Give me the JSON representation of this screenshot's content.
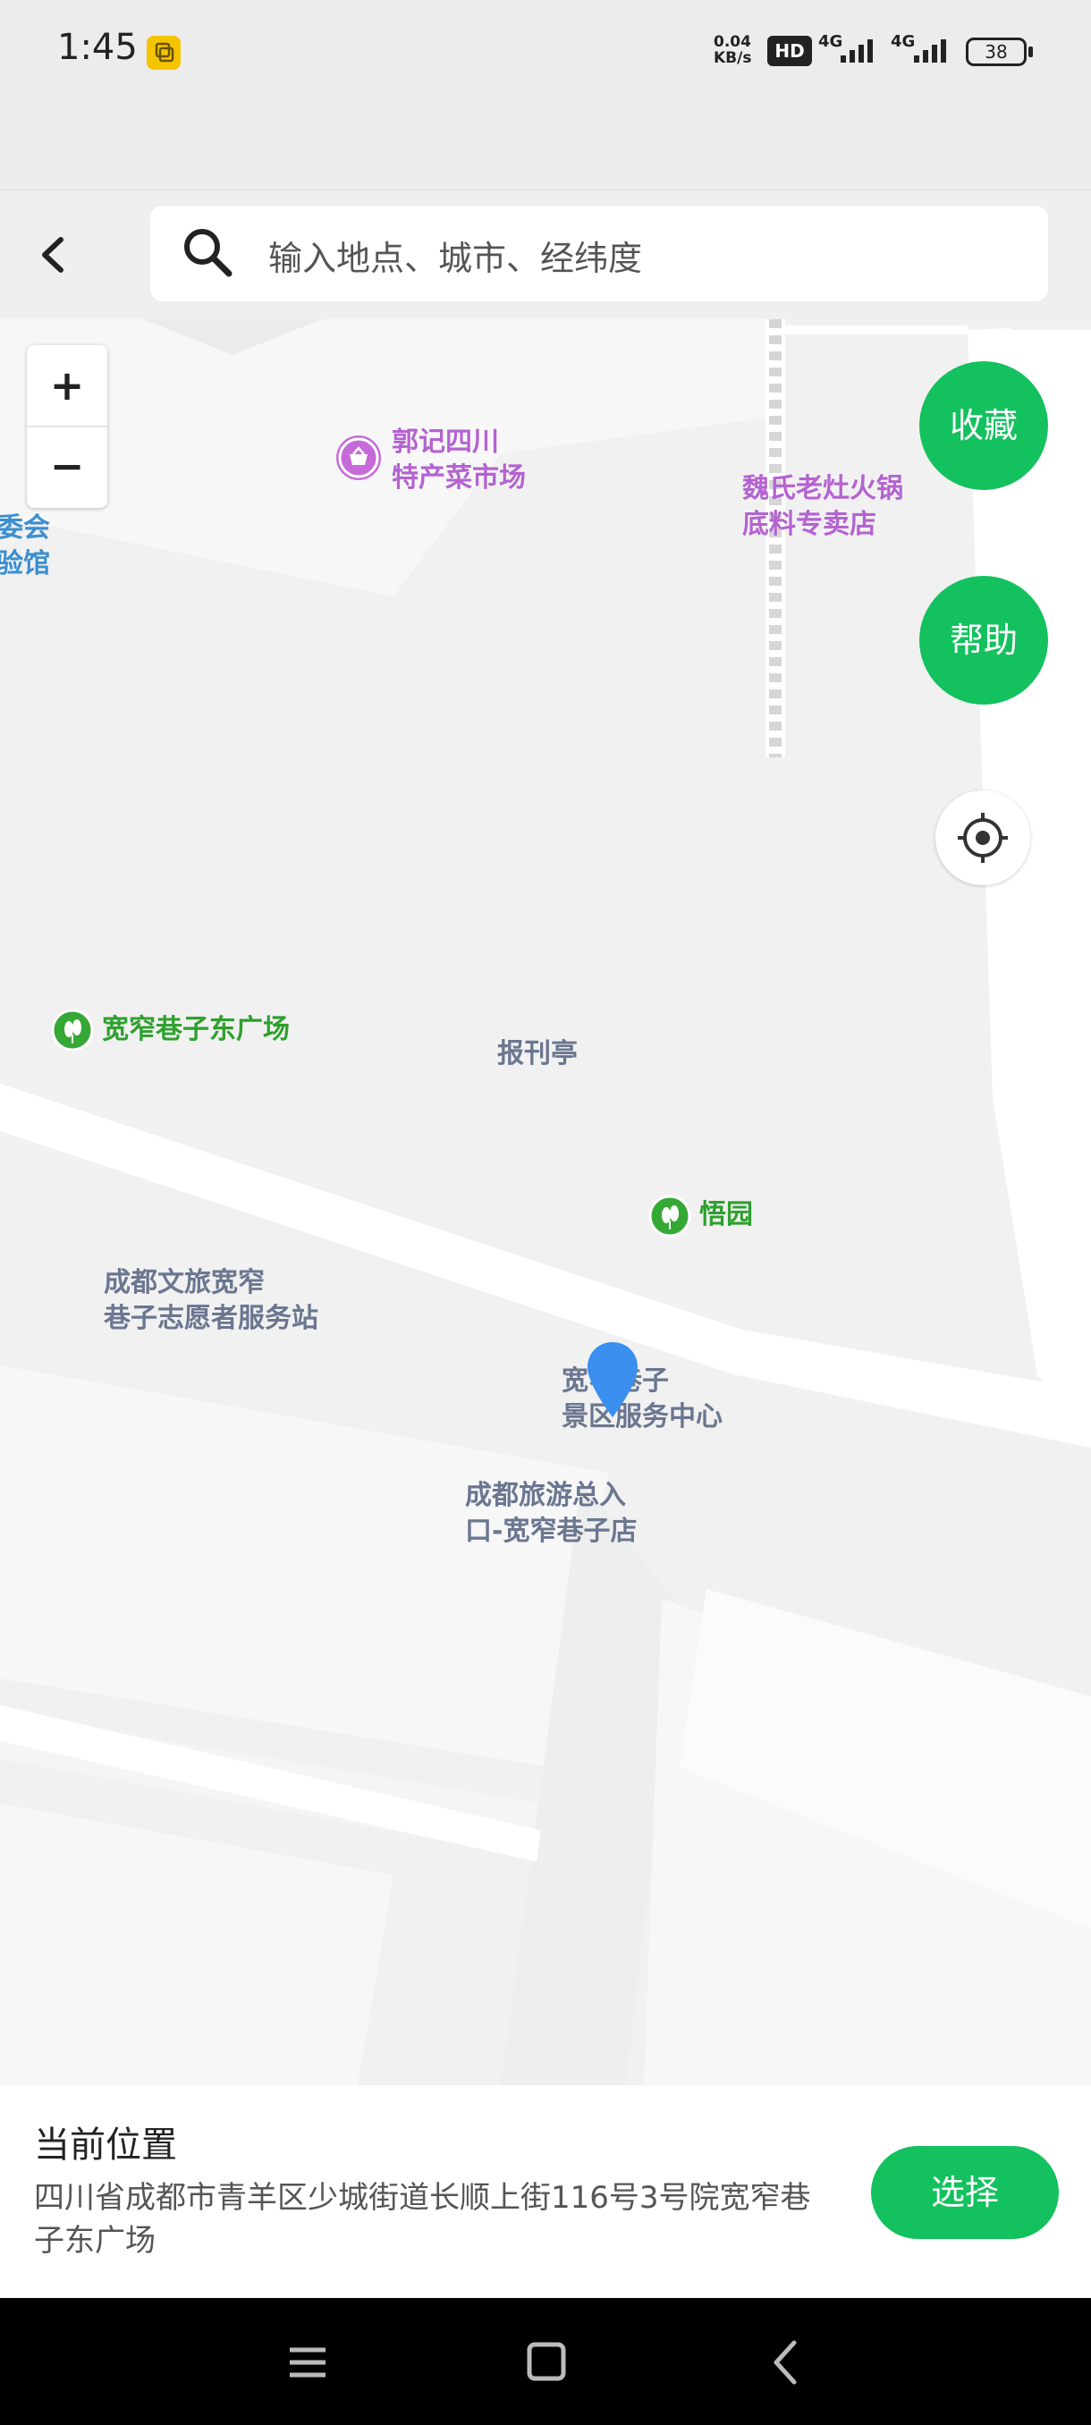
{
  "status_bar": {
    "time": "1:45",
    "net_speed_value": "0.04",
    "net_speed_unit": "KB/s",
    "hd_label": "HD",
    "signal_1": "4G",
    "signal_2": "4G",
    "battery": "38"
  },
  "header": {
    "back_icon": "chevron-left-icon",
    "search_icon": "search-icon",
    "search_placeholder": "输入地点、城市、经纬度"
  },
  "map": {
    "zoom_in": "+",
    "zoom_out": "−",
    "favorite_label": "收藏",
    "help_label": "帮助",
    "locate_icon": "crosshair-icon",
    "pois": {
      "guoji_line1": "郭记四川",
      "guoji_line2": "特产菜市场",
      "weishi_line1": "魏氏老灶火锅",
      "weishi_line2": "底料专卖店",
      "left_line1": "委会",
      "left_line2": "验馆",
      "kuanzhai_square": "宽窄巷子东广场",
      "newsstand": "报刊亭",
      "wuyuan": "悟园",
      "volunteer_line1": "成都文旅宽窄",
      "volunteer_line2": "巷子志愿者服务站",
      "service_line1": "宽窄巷子",
      "service_line2": "景区服务中心",
      "tourism_line1": "成都旅游总入",
      "tourism_line2": "口-宽窄巷子店"
    },
    "colors": {
      "green": "#13c15e",
      "purple": "#b463d0",
      "gray": "#6b7690",
      "pin": "#3a8fef"
    }
  },
  "bottom_panel": {
    "title": "当前位置",
    "address": "四川省成都市青羊区少城街道长顺上街116号3号院宽窄巷子东广场",
    "select_label": "选择"
  },
  "nav_bar": {
    "menu_icon": "menu-icon",
    "home_icon": "square-home-icon",
    "back_icon": "triangle-back-icon"
  }
}
